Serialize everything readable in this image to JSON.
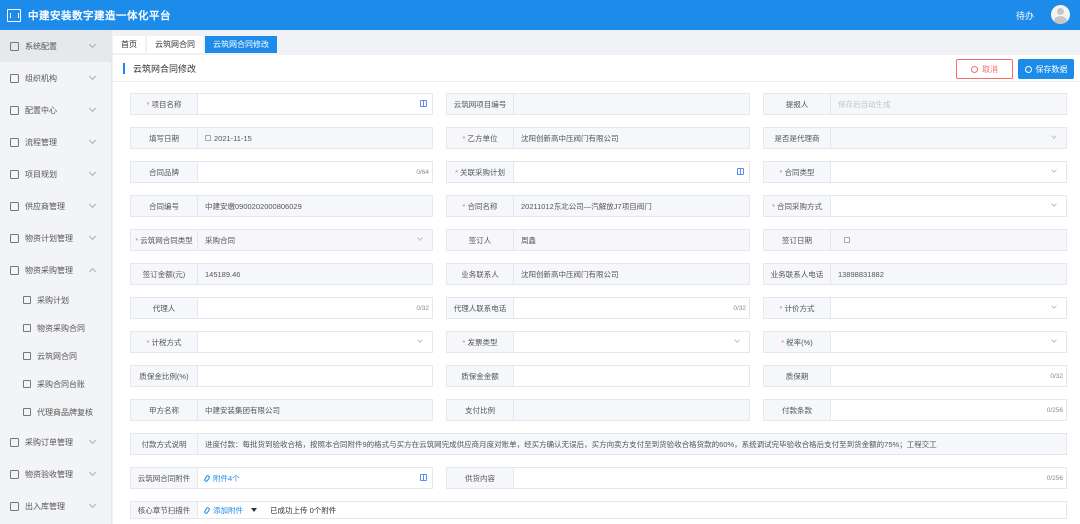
{
  "app": {
    "title": "中建安装数字建造一体化平台",
    "user": "待办"
  },
  "sidebar": {
    "items": [
      {
        "label": "系统配置"
      },
      {
        "label": "组织机构"
      },
      {
        "label": "配置中心"
      },
      {
        "label": "流程管理"
      },
      {
        "label": "项目规划"
      },
      {
        "label": "供应商管理"
      },
      {
        "label": "物资计划管理"
      },
      {
        "label": "物资采购管理"
      },
      {
        "label": "采购订单管理"
      },
      {
        "label": "物资验收管理"
      },
      {
        "label": "出入库管理"
      }
    ],
    "subitems": [
      {
        "label": "采购计划"
      },
      {
        "label": "物资采购合同"
      },
      {
        "label": "云筑网合同"
      },
      {
        "label": "采购合同台账"
      },
      {
        "label": "代理商品牌复核"
      }
    ]
  },
  "tabs": [
    {
      "label": "首页"
    },
    {
      "label": "云筑网合同"
    },
    {
      "label": "云筑网合同修改"
    }
  ],
  "page": {
    "title": "云筑网合同修改",
    "cancel": "取消",
    "save": "保存数据"
  },
  "form": {
    "project_name": {
      "label": "项目名称",
      "value": ""
    },
    "yz_project_no": {
      "label": "云筑网项目编号",
      "value": ""
    },
    "proposer": {
      "label": "提报人",
      "placeholder": "保存后自动生成"
    },
    "fill_date": {
      "label": "填写日期",
      "value": "2021-11-15"
    },
    "party_b": {
      "label": "乙方单位",
      "value": "沈阳创新高中压阀门有限公司"
    },
    "is_agent": {
      "label": "是否是代理商",
      "value": ""
    },
    "brand": {
      "label": "合同品牌",
      "count": "0/64"
    },
    "purchase_plan": {
      "label": "关联采购计划",
      "value": ""
    },
    "contract_type": {
      "label": "合同类型",
      "value": ""
    },
    "contract_no": {
      "label": "合同编号",
      "value": "中建安缴0900202000806029"
    },
    "contract_name": {
      "label": "合同名称",
      "value": "20211012东北公司—汽解放J7项目阀门"
    },
    "purchase_method": {
      "label": "合同采购方式",
      "value": ""
    },
    "yz_contract_type": {
      "label": "云筑网合同类型",
      "value": "采购合同"
    },
    "signer": {
      "label": "签订人",
      "value": "周鑫"
    },
    "sign_date": {
      "label": "签订日期",
      "value": ""
    },
    "amount": {
      "label": "签订金额(元)",
      "value": "145189.46"
    },
    "business_contact": {
      "label": "业务联系人",
      "value": "沈阳创新高中压阀门有限公司"
    },
    "business_phone": {
      "label": "业务联系人电话",
      "value": "13898831882"
    },
    "agent": {
      "label": "代理人",
      "count": "0/32"
    },
    "agent_phone": {
      "label": "代理人联系电话",
      "count": "0/32"
    },
    "pricing_method": {
      "label": "计价方式",
      "value": ""
    },
    "tax_method": {
      "label": "计税方式",
      "value": ""
    },
    "invoice_type": {
      "label": "发票类型",
      "value": ""
    },
    "tax_rate": {
      "label": "税率(%)",
      "value": ""
    },
    "warranty_ratio": {
      "label": "质保金比例(%)",
      "value": ""
    },
    "warranty_amount": {
      "label": "质保金金额",
      "value": ""
    },
    "warranty_period": {
      "label": "质保期",
      "count": "0/32"
    },
    "party_a": {
      "label": "甲方名称",
      "value": "中建安装集团有限公司"
    },
    "pay_ratio": {
      "label": "支付比例",
      "value": ""
    },
    "pay_terms": {
      "label": "付款条款",
      "count": "0/256"
    },
    "pay_desc": {
      "label": "付款方式说明",
      "value": "进度付款：每批货到验收合格，按照本合同附件9的格式与买方在云筑网完成供应商月度对账单，经买方确认无误后，买方向卖方支付至到货验收合格货款的60%，系统调试完毕验收合格后支付至到货金额的75%；工程交工"
    },
    "attachment": {
      "label": "云筑网合同附件",
      "value": "附件4个"
    },
    "supply_content": {
      "label": "供货内容",
      "count": "0/256"
    },
    "scan": {
      "label": "核心章节扫描件",
      "add": "添加附件",
      "message": "已成功上传 0个附件"
    }
  }
}
